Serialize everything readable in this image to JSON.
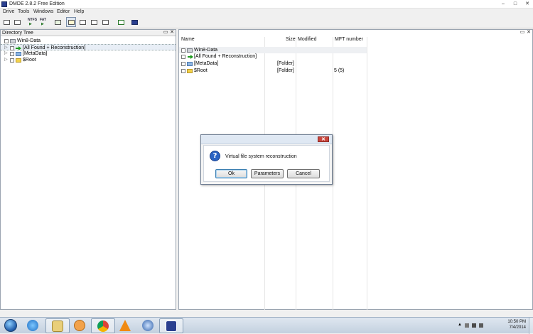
{
  "window": {
    "title": "DMDE 2.8.2 Free Edition",
    "controls": {
      "minimize": "–",
      "maximize": "□",
      "close": "✕"
    }
  },
  "menu": [
    "Drive",
    "Tools",
    "Windows",
    "Editor",
    "Help"
  ],
  "toolbar": {
    "ntfs_label": "NTFS",
    "fat_label": "FAT"
  },
  "left_panel": {
    "title": "Directory Tree",
    "restore": "▭",
    "close": "✕",
    "items": [
      {
        "label": "Win8-Data",
        "icon": "drive-icon"
      },
      {
        "label": "[All Found + Reconstruction]",
        "icon": "green-arrow-icon"
      },
      {
        "label": "[MetaData]",
        "icon": "metadata-icon"
      },
      {
        "label": "$Root",
        "icon": "folder-icon"
      }
    ]
  },
  "right_panel": {
    "restore": "▭",
    "close": "✕",
    "columns": [
      "Name",
      "Size",
      "Modified",
      "MFT number"
    ],
    "rows": [
      {
        "name": "Win8-Data",
        "size": "",
        "modified": "",
        "mft": "",
        "icon": "drive-icon"
      },
      {
        "name": "[All Found + Reconstruction]",
        "size": "",
        "modified": "",
        "mft": "",
        "icon": "green-arrow-icon"
      },
      {
        "name": "[MetaData]",
        "size": "[Folder]",
        "modified": "",
        "mft": "",
        "icon": "metadata-icon"
      },
      {
        "name": "$Root",
        "size": "[Folder]",
        "modified": "",
        "mft": "5 (5)",
        "icon": "folder-icon"
      }
    ]
  },
  "dialog": {
    "close": "✕",
    "icon": "question-icon",
    "message": "Virtual file system reconstruction",
    "buttons": {
      "ok": "Ok",
      "parameters": "Parameters",
      "cancel": "Cancel"
    }
  },
  "taskbar": {
    "apps": [
      "start-orb",
      "internet-explorer-icon",
      "file-explorer-icon",
      "media-player-icon",
      "chrome-icon",
      "vlc-icon",
      "app-icon",
      "dmde-icon"
    ],
    "clock": {
      "time": "10:50 PM",
      "date": "7/4/2014"
    }
  },
  "colors": {
    "accent": "#2b64c4",
    "dialog_close": "#c9463d",
    "folder": "#f3d24a"
  }
}
